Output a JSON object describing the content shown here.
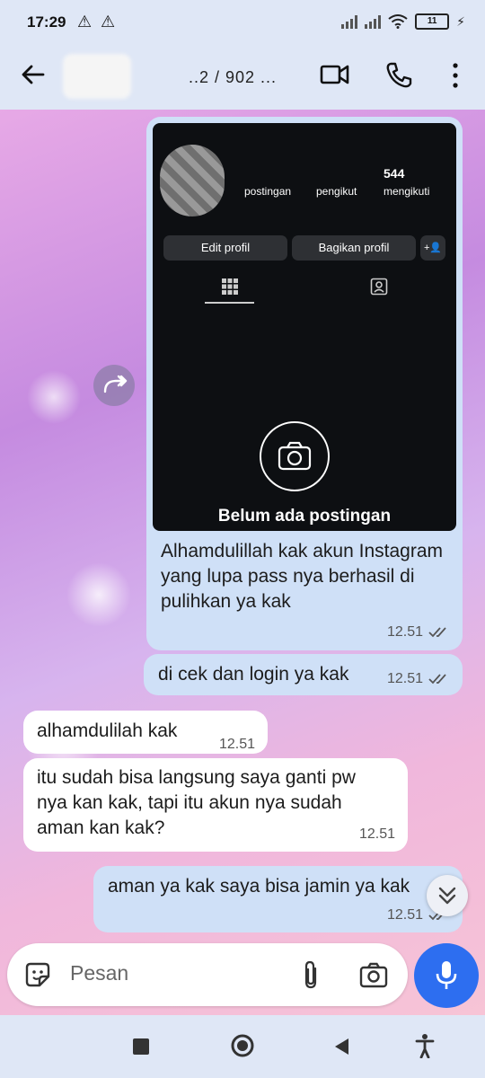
{
  "status_bar": {
    "time": "17:29",
    "battery": "11"
  },
  "header": {
    "contact_name": "..2 / 902 ..."
  },
  "instagram_screenshot": {
    "stat_following_value": "544",
    "stat_posts_label": "postingan",
    "stat_followers_label": "pengikut",
    "stat_following_label": "mengikuti",
    "edit_profile": "Edit profil",
    "share_profile": "Bagikan profil",
    "empty_caption": "Belum ada postingan"
  },
  "messages": [
    {
      "text": "Alhamdulillah kak akun Instagram yang lupa pass nya berhasil di pulihkan ya kak",
      "time": "12.51",
      "direction": "out"
    },
    {
      "text": "di cek dan login ya kak",
      "time": "12.51",
      "direction": "out"
    },
    {
      "text": "alhamdulilah kak",
      "time": "12.51",
      "direction": "in"
    },
    {
      "text": "itu sudah bisa langsung saya ganti pw nya kan kak, tapi itu akun nya sudah aman kan kak?",
      "time": "12.51",
      "direction": "in"
    },
    {
      "text": "aman ya kak saya bisa jamin ya kak",
      "time": "12.51",
      "direction": "out"
    }
  ],
  "composer": {
    "placeholder": "Pesan"
  }
}
